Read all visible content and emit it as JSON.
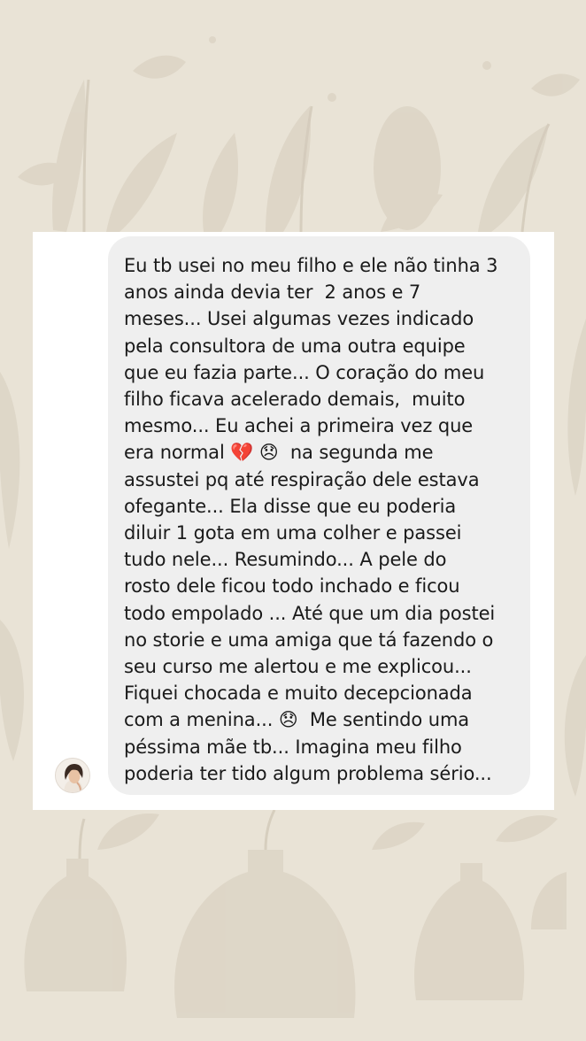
{
  "message": {
    "sender": "other",
    "lines": [
      "Eu tb usei no meu filho e ele não tinha 3",
      "anos ainda devia ter  2 anos e 7",
      "meses... Usei algumas vezes indicado",
      "pela consultora de uma outra equipe",
      "que eu fazia parte... O coração do meu",
      "filho ficava acelerado demais,  muito",
      "mesmo... Eu achei a primeira vez que",
      "era normal 💔 😞  na segunda me",
      "assustei pq até respiração dele estava",
      "ofegante... Ela disse que eu poderia",
      "diluir 1 gota em uma colher e passei",
      "tudo nele... Resumindo... A pele do",
      "rosto dele ficou todo inchado e ficou",
      "todo empolado ... Até que um dia postei",
      "no storie e uma amiga que tá fazendo o",
      "seu curso me alertou e me explicou...",
      "Fiquei chocada e muito decepcionada",
      "com a menina... 😞  Me sentindo uma",
      "péssima mãe tb... Imagina meu filho",
      "poderia ter tido algum problema sério..."
    ]
  },
  "avatar": {
    "icon": "user-avatar"
  },
  "colors": {
    "background": "#e9e3d6",
    "card": "#ffffff",
    "bubble": "#efefef",
    "text": "#1a1a1a"
  }
}
